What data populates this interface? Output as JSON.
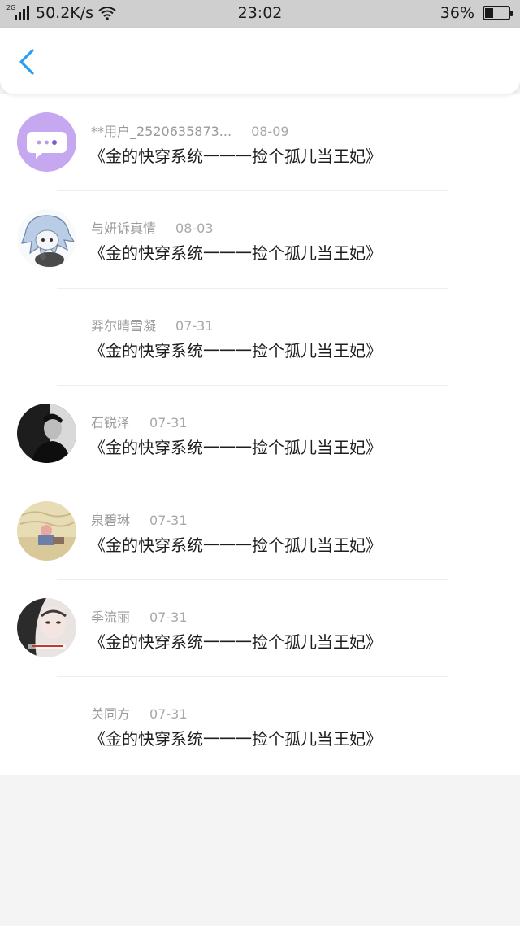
{
  "status_bar": {
    "network_type": "2G",
    "speed": "50.2K/s",
    "time": "23:02",
    "battery_percent": "36%",
    "battery_level": 0.36
  },
  "nav": {
    "back_icon": "chevron-left-icon",
    "accent_color": "#2a9ff0"
  },
  "comments": [
    {
      "user": "**用户_2520635873...",
      "date": "08-09",
      "text": "《金的快穿系统一一一捡个孤儿当王妃》",
      "avatar": "purple-chat-bubble"
    },
    {
      "user": "与妍诉真情",
      "date": "08-03",
      "text": "《金的快穿系统一一一捡个孤儿当王妃》",
      "avatar": "anime-character"
    },
    {
      "user": "羿尔晴雪凝",
      "date": "07-31",
      "text": "《金的快穿系统一一一捡个孤儿当王妃》",
      "avatar": "none"
    },
    {
      "user": "石锐泽",
      "date": "07-31",
      "text": "《金的快穿系统一一一捡个孤儿当王妃》",
      "avatar": "bw-portrait"
    },
    {
      "user": "泉碧琳",
      "date": "07-31",
      "text": "《金的快穿系统一一一捡个孤儿当王妃》",
      "avatar": "cartoon-illustration"
    },
    {
      "user": "季流丽",
      "date": "07-31",
      "text": "《金的快穿系统一一一捡个孤儿当王妃》",
      "avatar": "girl-photo"
    },
    {
      "user": "关同方",
      "date": "07-31",
      "text": "《金的快穿系统一一一捡个孤儿当王妃》",
      "avatar": "none"
    }
  ]
}
